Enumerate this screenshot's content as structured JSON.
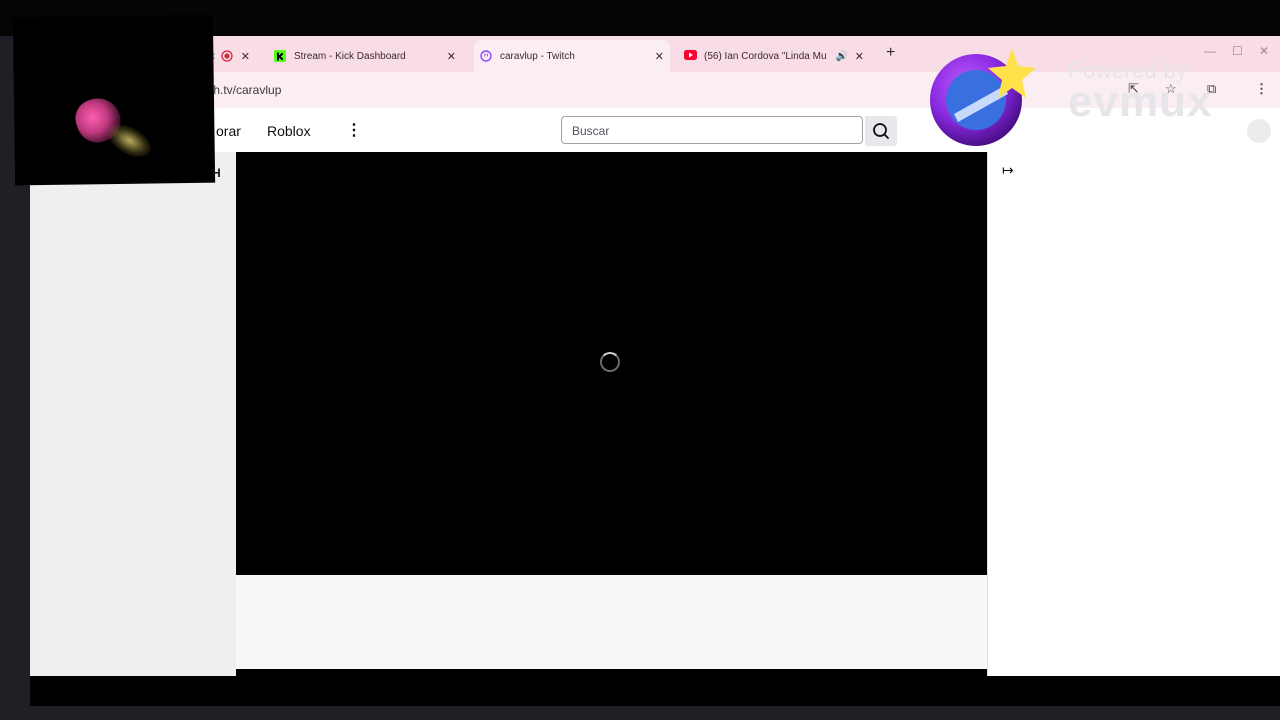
{
  "browser": {
    "tabs": [
      {
        "title": "",
        "icon": "recording-icon",
        "active": false
      },
      {
        "title": "Stream - Kick Dashboard",
        "icon": "kick-icon",
        "active": false
      },
      {
        "title": "caravlup - Twitch",
        "icon": "twitch-icon",
        "active": true
      },
      {
        "title": "(56) Ian Cordova \"Linda Mu",
        "icon": "youtube-icon",
        "active": false
      }
    ],
    "new_tab_label": "+",
    "url": "tch.tv/caravlup"
  },
  "twitch": {
    "nav": [
      {
        "label": "orar"
      },
      {
        "label": "Roblox"
      }
    ],
    "more_label": "⋮",
    "search_placeholder": "Buscar",
    "collapse_label": "↦",
    "logo_fragment": "H"
  },
  "overlay": {
    "powered_by": "Powered by",
    "brand": "evmux"
  },
  "colors": {
    "tabstrip": "#f9dde6",
    "player": "#000000",
    "sidebar": "#efeff1",
    "youtube_red": "#ff0033",
    "kick_green": "#53fc18",
    "twitch_purple": "#9146ff"
  }
}
